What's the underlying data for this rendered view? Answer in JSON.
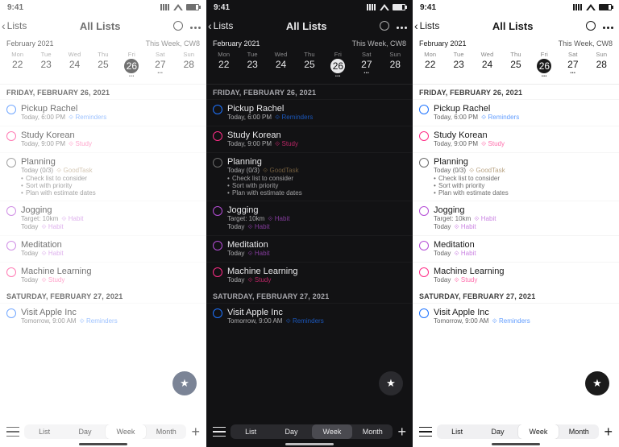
{
  "statusbar": {
    "time": "9:41"
  },
  "panels": [
    {
      "theme": "light-faded",
      "back_label": "Lists",
      "title": "All Lists",
      "month": "February 2021",
      "week_label": "This Week, CW8"
    },
    {
      "theme": "dark",
      "back_label": "Lists",
      "title": "All Lists",
      "month": "February 2021",
      "week_label": "This Week, CW8"
    },
    {
      "theme": "light",
      "back_label": "Lists",
      "title": "All Lists",
      "month": "February 2021",
      "week_label": "This Week, CW8"
    }
  ],
  "week_days": [
    {
      "dow": "Mon",
      "num": "22",
      "today": false
    },
    {
      "dow": "Tue",
      "num": "23",
      "today": false
    },
    {
      "dow": "Wed",
      "num": "24",
      "today": false
    },
    {
      "dow": "Thu",
      "num": "25",
      "today": false
    },
    {
      "dow": "Fri",
      "num": "26",
      "today": true
    },
    {
      "dow": "Sat",
      "num": "27",
      "today": false
    },
    {
      "dow": "Sun",
      "num": "28",
      "today": false
    }
  ],
  "sections": [
    {
      "header": "FRIDAY, FEBRUARY 26, 2021",
      "tasks": [
        {
          "title": "Pickup Rachel",
          "subtitle": "Today, 6:00 PM",
          "tag": "Reminders",
          "ring": "#1e73ff",
          "tag_color": "#1e73ff",
          "notes": []
        },
        {
          "title": "Study Korean",
          "subtitle": "Today, 9:00 PM",
          "tag": "Study",
          "ring": "#ff2d87",
          "tag_color": "#ff2d87",
          "notes": []
        },
        {
          "title": "Planning",
          "subtitle": "Today (0/3)",
          "tag": "GoodTask",
          "ring": "#6b6b6b",
          "tag_color": "#9a7c4f",
          "notes": [
            "Check list to consider",
            "Sort with priority",
            "Plan with estimate dates"
          ]
        },
        {
          "title": "Jogging",
          "subtitle": "Target: 10km",
          "tag": "Habit",
          "ring": "#b44dd6",
          "tag_color": "#b44dd6",
          "notes": [],
          "subtitle2": "Today"
        },
        {
          "title": "Meditation",
          "subtitle": "Today",
          "tag": "Habit",
          "ring": "#b44dd6",
          "tag_color": "#b44dd6",
          "notes": []
        },
        {
          "title": "Machine Learning",
          "subtitle": "Today",
          "tag": "Study",
          "ring": "#ff2d87",
          "tag_color": "#ff2d87",
          "notes": []
        }
      ]
    },
    {
      "header": "SATURDAY, FEBRUARY 27, 2021",
      "tasks": [
        {
          "title": "Visit Apple Inc",
          "subtitle": "Tomorrow, 9:00 AM",
          "tag": "Reminders",
          "ring": "#1e73ff",
          "tag_color": "#1e73ff",
          "notes": []
        }
      ]
    }
  ],
  "segments": [
    "List",
    "Day",
    "Week",
    "Month"
  ],
  "segment_selected": 2
}
